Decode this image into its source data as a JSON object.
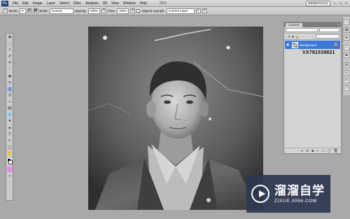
{
  "menubar": {
    "logo": "Ps",
    "items": [
      "File",
      "Edit",
      "Image",
      "Layer",
      "Select",
      "Filter",
      "Analysis",
      "3D",
      "View",
      "Window",
      "Help"
    ],
    "zoom": "50%",
    "workspace": "ESSENTIALS",
    "window_controls": [
      "–",
      "□",
      "×"
    ]
  },
  "options": {
    "brush_label": "Brush:",
    "brush_size": "9",
    "mode_label": "Mode:",
    "mode_value": "Normal",
    "opacity_label": "Opacity:",
    "opacity_value": "100%",
    "flow_label": "Flow:",
    "flow_value": "100%",
    "aligned_label": "Aligned",
    "sample_label": "Sample:",
    "sample_value": "Current Layer"
  },
  "layers_panel": {
    "tab_label": "LAYERS",
    "layer_name": "Background",
    "watermark_id": "VX781539821"
  },
  "site_logo": {
    "name": "溜溜自学",
    "url": "ZIXUE.3066.COM"
  },
  "colors": {
    "accent": "#3c78d8",
    "panel": "#d4d4d4",
    "workspace_bg": "#a9a9a9",
    "logo_bg": "#2d3750"
  },
  "icons": [
    "move-tool-icon",
    "marquee-tool-icon",
    "lasso-tool-icon",
    "quick-selection-icon",
    "crop-tool-icon",
    "eyedropper-icon",
    "healing-brush-icon",
    "brush-tool-icon",
    "clone-stamp-icon",
    "history-brush-icon",
    "eraser-icon",
    "gradient-icon",
    "blur-icon",
    "dodge-icon",
    "pen-tool-icon",
    "type-tool-icon",
    "path-selection-icon",
    "shape-tool-icon",
    "hand-tool-icon",
    "zoom-tool-icon"
  ]
}
